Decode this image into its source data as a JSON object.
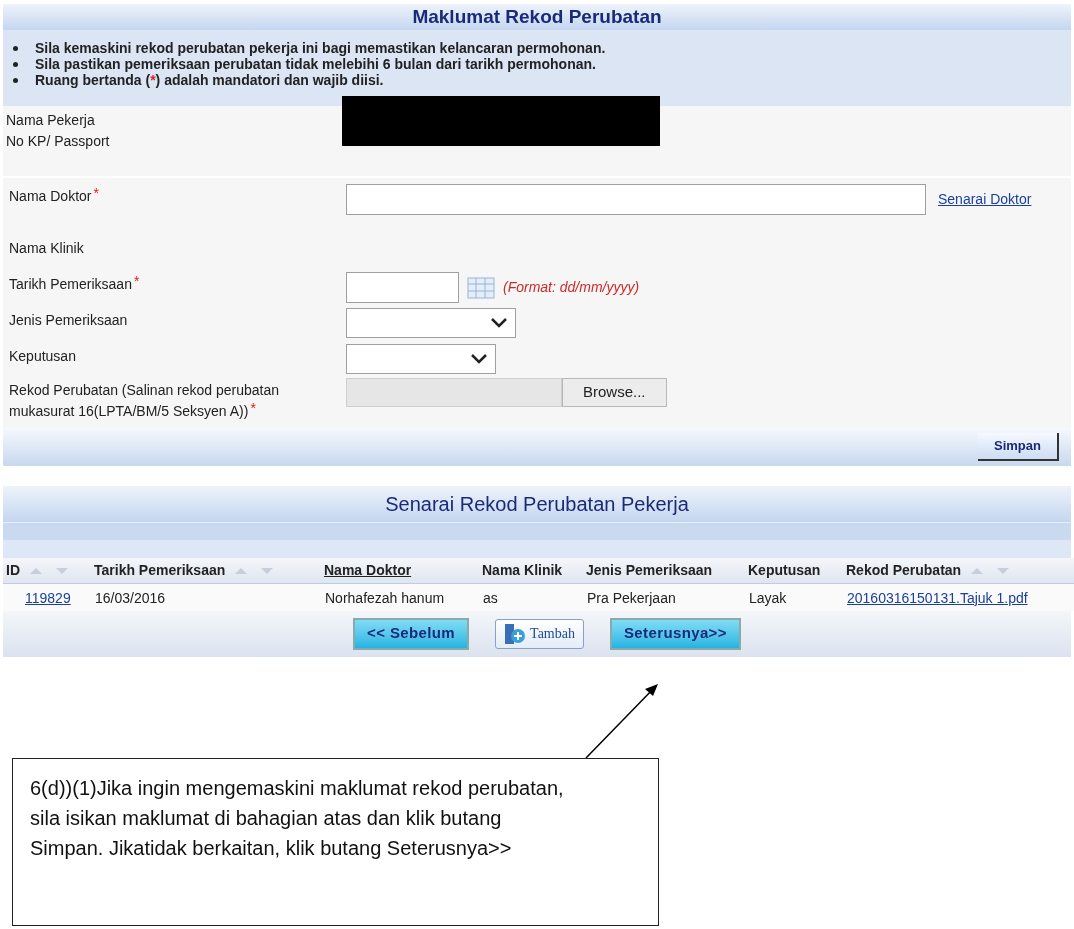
{
  "form": {
    "title": "Maklumat Rekod Perubatan",
    "notes": [
      {
        "segments": [
          {
            "kind": "plain",
            "text": "Sila kemaskini rekod perubatan pekerja ini bagi memastikan kelancaran permohonan."
          }
        ]
      },
      {
        "segments": [
          {
            "kind": "plain",
            "text": "Sila pastikan pemeriksaan perubatan tidak melebihi 6 bulan dari tarikh permohonan."
          }
        ]
      },
      {
        "segments": [
          {
            "kind": "plain",
            "text": "Ruang bertanda ("
          },
          {
            "kind": "required",
            "text": "*"
          },
          {
            "kind": "plain",
            "text": ") adalah mandatori dan wajib diisi."
          }
        ]
      }
    ],
    "employee": [
      {
        "label": "Nama Pekerja"
      },
      {
        "label": "No KP/ Passport"
      }
    ],
    "fields": [
      {
        "kind": "text",
        "label": "Nama Doktor",
        "required": true,
        "link": "Senarai Doktor"
      },
      {
        "kind": "static",
        "label": "Nama Klinik",
        "required": false
      },
      {
        "kind": "date",
        "label": "Tarikh Pemeriksaan",
        "required": true,
        "hint": "(Format: dd/mm/yyyy)"
      },
      {
        "kind": "select",
        "label": "Jenis Pemeriksaan",
        "required": false
      },
      {
        "kind": "select",
        "label": "Keputusan",
        "required": false
      },
      {
        "kind": "file",
        "label": "Rekod Perubatan (Salinan rekod perubatan mukasurat 16(LPTA/BM/5 Seksyen A))",
        "required": true,
        "button": "Browse..."
      }
    ],
    "save_button": "Simpan"
  },
  "records": {
    "title": "Senarai Rekod Perubatan Pekerja",
    "columns": [
      {
        "label": "ID",
        "kind": "sort"
      },
      {
        "label": "Tarikh Pemeriksaan",
        "kind": "sort"
      },
      {
        "label": "Nama Doktor",
        "kind": "link"
      },
      {
        "label": "Nama Klinik",
        "kind": "plain"
      },
      {
        "label": "Jenis Pemeriksaan",
        "kind": "plain"
      },
      {
        "label": "Keputusan",
        "kind": "plain"
      },
      {
        "label": "Rekod Perubatan",
        "kind": "sort"
      }
    ],
    "rows": [
      {
        "cells": [
          {
            "kind": "link",
            "text": "119829"
          },
          {
            "kind": "text",
            "text": "16/03/2016"
          },
          {
            "kind": "text",
            "text": "Norhafezah hanum"
          },
          {
            "kind": "text",
            "text": "as"
          },
          {
            "kind": "text",
            "text": "Pra Pekerjaan"
          },
          {
            "kind": "text",
            "text": "Layak"
          },
          {
            "kind": "link",
            "text": "20160316150131.Tajuk 1.pdf"
          }
        ]
      }
    ],
    "buttons": [
      {
        "kind": "nav",
        "label": "<< Sebelum"
      },
      {
        "kind": "add",
        "label": "Tambah"
      },
      {
        "kind": "nav",
        "label": "Seterusnya>>"
      }
    ]
  },
  "callout": {
    "text": "6(d))(1)Jika ingin mengemaskini maklumat rekod perubatan, sila isikan maklumat di bahagian atas dan klik butang Simpan. Jikatidak berkaitan, klik butang Seterusnya>>"
  }
}
